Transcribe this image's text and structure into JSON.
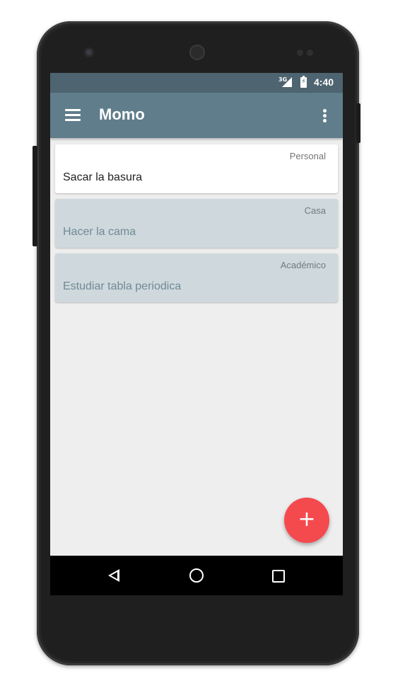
{
  "status_bar": {
    "network": "3G",
    "time": "4:40"
  },
  "app_bar": {
    "title": "Momo",
    "menu_icon": "hamburger-menu-icon",
    "overflow_icon": "more-vert-icon"
  },
  "tasks": [
    {
      "category": "Personal",
      "title": "Sacar la basura",
      "state": "active"
    },
    {
      "category": "Casa",
      "title": "Hacer la cama",
      "state": "done"
    },
    {
      "category": "Académico",
      "title": "Estudiar tabla periodica",
      "state": "done"
    }
  ],
  "fab": {
    "label": "+",
    "icon": "add-icon",
    "color": "#f44a4e"
  },
  "nav_bar": {
    "icons": [
      "back-icon",
      "home-icon",
      "recent-apps-icon"
    ]
  },
  "colors": {
    "primary": "#607d8b",
    "primary_dark": "#4e6470",
    "done_card": "#cfd8dc",
    "accent": "#f44a4e"
  }
}
